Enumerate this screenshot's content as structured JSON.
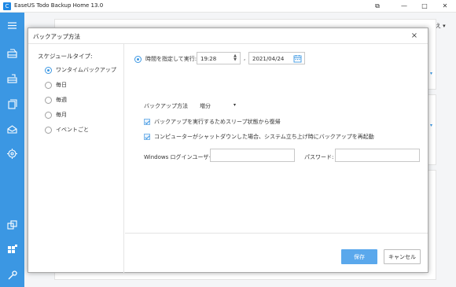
{
  "app": {
    "logo": "C",
    "title": "EaseUS Todo Backup Home 13.0",
    "window_buttons": {
      "pin": "⧉",
      "minimize": "—",
      "maximize": "□",
      "close": "✕"
    }
  },
  "background": {
    "sort_label": "↑↓ 並び替え ▾"
  },
  "dialog": {
    "title": "バックアップ方法",
    "close_glyph": "×",
    "schedule_type_label": "スケジュールタイプ:",
    "schedule_options": [
      {
        "label": "ワンタイムバックアップ",
        "selected": true
      },
      {
        "label": "毎日",
        "selected": false
      },
      {
        "label": "毎週",
        "selected": false
      },
      {
        "label": "毎月",
        "selected": false
      },
      {
        "label": "イベントごと",
        "selected": false
      }
    ],
    "specify_time": {
      "label": "時間を指定して実行:",
      "selected": true,
      "time_value": "19:28",
      "separator": ",",
      "date_value": "2021/04/24"
    },
    "backup_method": {
      "label": "バックアップ方法",
      "value": "増分"
    },
    "options": [
      {
        "label": "バックアップを実行するためスリープ状態から復帰",
        "checked": true
      },
      {
        "label": "コンピューターがシャットダウンした場合、システム立ち上げ時にバックアップを再起動",
        "checked": true
      }
    ],
    "login": {
      "user_label": "Windows ログインユーザー:",
      "user_value": "",
      "password_label": "パスワード:",
      "password_value": ""
    },
    "buttons": {
      "save": "保存",
      "cancel": "キャンセル"
    }
  },
  "colors": {
    "accent": "#3b97e3",
    "sidebar": "#3b97e3",
    "primary_button": "#5aa8ec"
  },
  "icons": [
    "menu-icon",
    "backup-disk-icon",
    "system-backup-icon",
    "file-backup-icon",
    "mail-backup-icon",
    "smart-backup-icon",
    "clone-icon",
    "tools-icon",
    "wrench-icon"
  ]
}
